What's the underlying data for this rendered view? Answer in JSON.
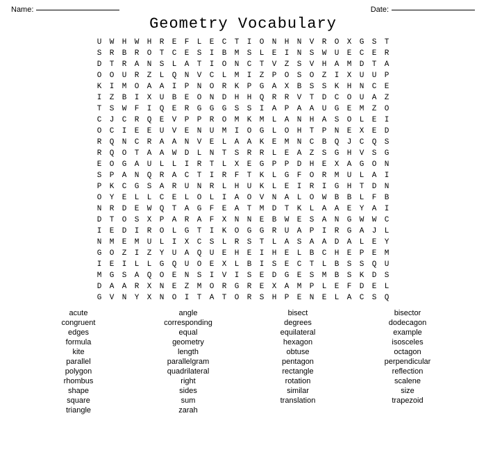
{
  "header": {
    "name_label": "Name:",
    "date_label": "Date:"
  },
  "title": "Geometry Vocabulary",
  "grid": [
    "U W H W H R E F L E C T I O N H N V R O X G S T",
    "S R B R O T C E S I B M S L E I N S W U E C E R",
    "D T R A N S L A T I O N C T V Z S V H A M D T A",
    "O O U R Z L Q N V C L M I Z P O S O Z I X U U P",
    "K I M O A A I P N O R K P G A X B S S K H N C E",
    "I Z B I X U B E O N D H H Q R R V T D C O U A Z",
    "T S W F I Q E R G G G S S I A P A A U G E M Z O",
    "C J C R Q E V P P R O M K M L A N H A S O L E I",
    "O C I E E U V E N U M I O G L O H T P N E X E D",
    "R Q N C R A A N V E L A A K E M N C B Q J C Q S",
    "R Q O T A A W D L N T S R R L E A Z S G H V S G",
    "E O G A U L L I R T L X E G P P D H E X A G O N",
    "S P A N Q R A C T I R F T K L G F O R M U L A I",
    "P K C G S A R U N R L H U K L E I R I G H T D N",
    "O Y E L L C E L O L I A O V N A L O W B B L F B",
    "N R D E W Q T A G F E A T M D T K L A A E Y A I",
    "D T O S X P A R A F X N N E B W E S A N G W W C",
    "I E D I R O L G T I K O G G R U A P I R G A J L",
    "N M E M U L I X C S L R S T L A S A A D A L E Y",
    "G O Z I Z Y U A Q U E H E I H E L B C H E P E M",
    "I E I L L G Q U O E X L B I S E C T L B S S Q U",
    "M G S A Q O E N S I V I S E D G E S M B S K D S",
    "D A A R X N E Z M O R G R E X A M P L E F D E L",
    "G V N Y X N O I T A T O R S H P E N E L A C S Q"
  ],
  "word_list": [
    "acute",
    "angle",
    "bisect",
    "bisector",
    "congruent",
    "corresponding",
    "degrees",
    "dodecagon",
    "edges",
    "equal",
    "equilateral",
    "example",
    "formula",
    "geometry",
    "hexagon",
    "isosceles",
    "kite",
    "length",
    "obtuse",
    "octagon",
    "parallel",
    "parallelgram",
    "pentagon",
    "perpendicular",
    "polygon",
    "quadrilateral",
    "rectangle",
    "reflection",
    "rhombus",
    "right",
    "rotation",
    "scalene",
    "shape",
    "sides",
    "similar",
    "size",
    "square",
    "sum",
    "translation",
    "trapezoid",
    "triangle",
    "zarah",
    "",
    ""
  ]
}
